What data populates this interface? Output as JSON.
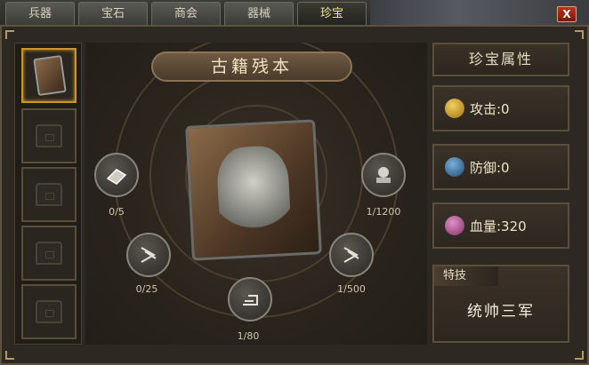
{
  "tabs": [
    {
      "label": "兵器",
      "active": false
    },
    {
      "label": "宝石",
      "active": false
    },
    {
      "label": "商会",
      "active": false
    },
    {
      "label": "器械",
      "active": false
    },
    {
      "label": "珍宝",
      "active": true
    }
  ],
  "close_label": "X",
  "treasure": {
    "name": "古籍残本"
  },
  "materials": [
    {
      "id": "top-left",
      "count": "0/5"
    },
    {
      "id": "mid-left",
      "count": "0/25"
    },
    {
      "id": "bottom",
      "count": "1/80"
    },
    {
      "id": "mid-right",
      "count": "1/500"
    },
    {
      "id": "top-right",
      "count": "1/1200"
    }
  ],
  "attributes": {
    "title": "珍宝属性",
    "attack": "攻击:0",
    "defense": "防御:0",
    "hp": "血量:320"
  },
  "skill": {
    "header": "特技",
    "name": "统帅三军"
  },
  "icons": {
    "attack": "sword-orb-icon",
    "defense": "shield-orb-icon",
    "hp": "heart-orb-icon",
    "slot": "chest-icon"
  },
  "colors": {
    "accent_gold": "#c9952c",
    "text_light": "#efe3c6",
    "close_red": "#c0301c"
  }
}
